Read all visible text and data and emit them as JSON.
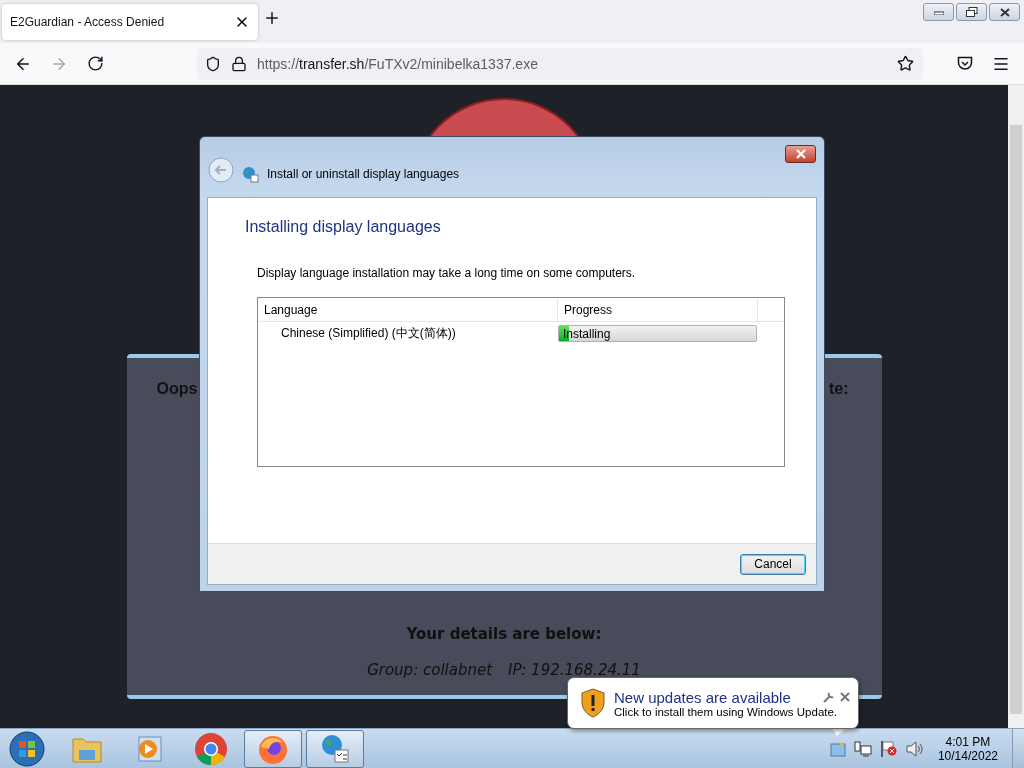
{
  "browser": {
    "tab": {
      "title": "E2Guardian - Access Denied",
      "selected": true
    },
    "url": {
      "scheme": "https://",
      "host": "transfer.sh",
      "path": "/FuTXv2/minibelka1337.exe"
    }
  },
  "page": {
    "heading_left": "Oops",
    "heading_right": "te:",
    "details_title": "Your details are below:",
    "group": "Group: collabnet",
    "ip": "IP: 192.168.24.11"
  },
  "dialog": {
    "title": "Install or uninstall display languages",
    "heading": "Installing display languages",
    "description": "Display language installation may take a long time on some computers.",
    "columns": [
      "Language",
      "Progress"
    ],
    "rows": [
      {
        "language": "Chinese (Simplified) (中文(简体))",
        "status": "Installing",
        "level": 0.05
      }
    ],
    "buttons": [
      {
        "label": "Cancel",
        "default": true
      }
    ]
  },
  "notification": {
    "title": "New updates are available",
    "message": "Click to install them using Windows Update."
  },
  "taskbar": {
    "items": [
      {
        "kind": "start",
        "active": false
      },
      {
        "kind": "explorer",
        "active": false
      },
      {
        "kind": "media",
        "active": false
      },
      {
        "kind": "chrome",
        "active": false
      },
      {
        "kind": "firefox",
        "active": true
      },
      {
        "kind": "language",
        "active": true
      }
    ],
    "clock": {
      "time": "4:01 PM",
      "date": "10/14/2022"
    }
  }
}
